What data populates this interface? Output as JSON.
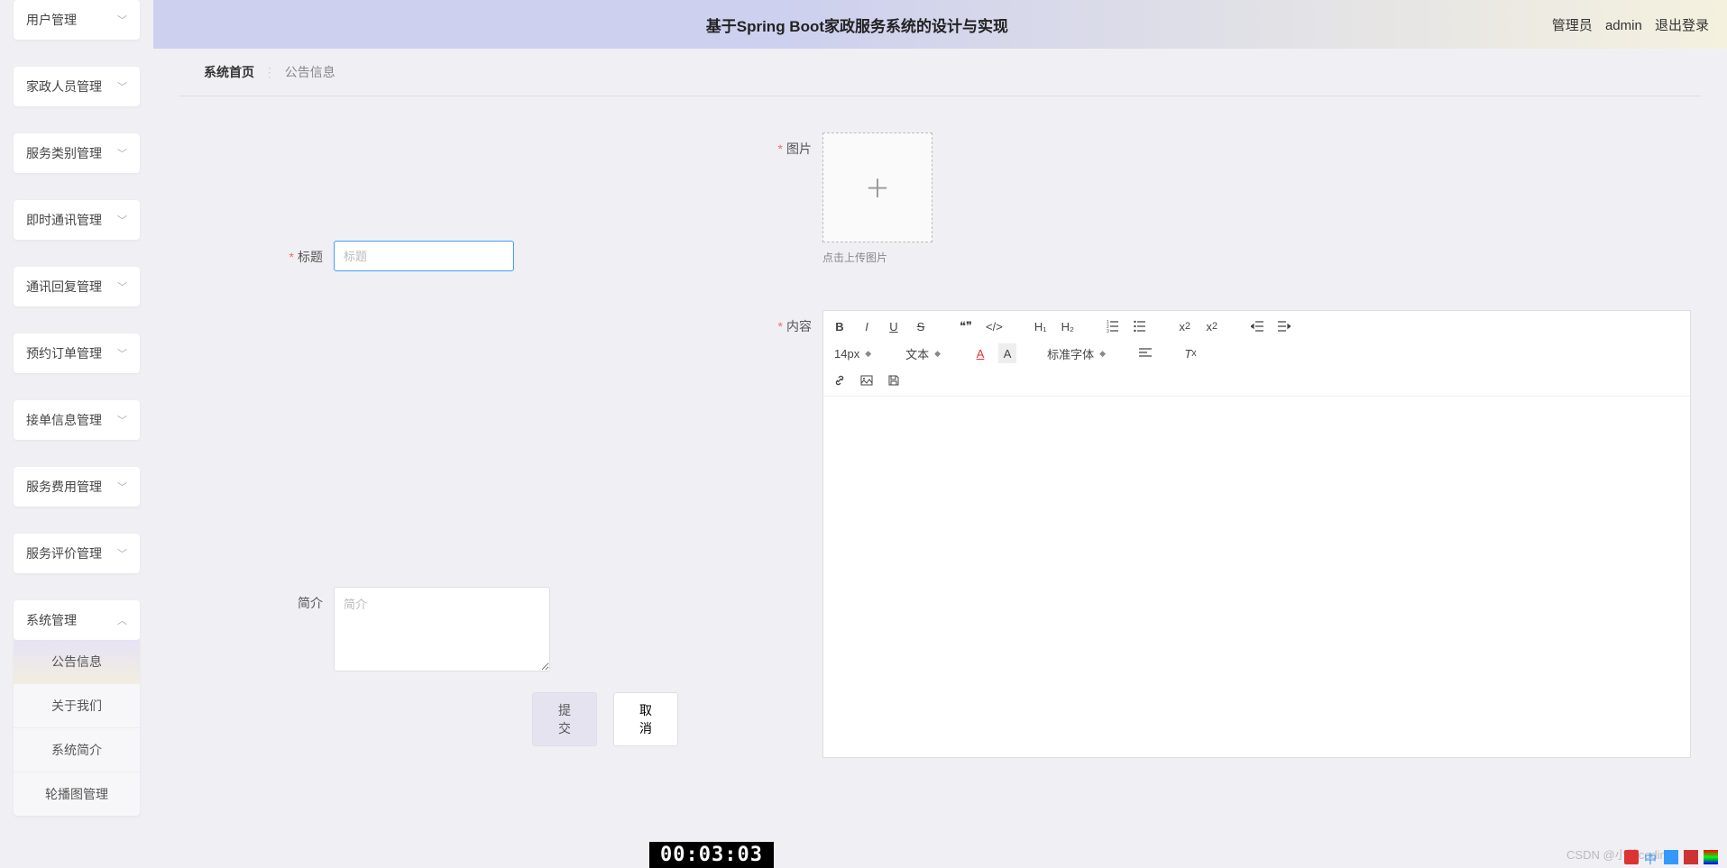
{
  "header": {
    "title": "基于Spring Boot家政服务系统的设计与实现",
    "role": "管理员",
    "user": "admin",
    "logout": "退出登录"
  },
  "breadcrumb": {
    "home": "系统首页",
    "current": "公告信息"
  },
  "sidebar": {
    "items": [
      {
        "label": "用户管理"
      },
      {
        "label": "家政人员管理"
      },
      {
        "label": "服务类别管理"
      },
      {
        "label": "即时通讯管理"
      },
      {
        "label": "通讯回复管理"
      },
      {
        "label": "预约订单管理"
      },
      {
        "label": "接单信息管理"
      },
      {
        "label": "服务费用管理"
      },
      {
        "label": "服务评价管理"
      },
      {
        "label": "系统管理"
      }
    ],
    "sub": [
      {
        "label": "公告信息"
      },
      {
        "label": "关于我们"
      },
      {
        "label": "系统简介"
      },
      {
        "label": "轮播图管理"
      }
    ]
  },
  "form": {
    "title_label": "标题",
    "title_placeholder": "标题",
    "intro_label": "简介",
    "intro_placeholder": "简介",
    "image_label": "图片",
    "upload_hint": "点击上传图片",
    "content_label": "内容",
    "submit": "提交",
    "cancel": "取消"
  },
  "editor": {
    "fontsize": "14px",
    "paragraph": "文本",
    "font": "标准字体",
    "h1": "H₁",
    "h2": "H₂"
  },
  "timer": "00:03:03",
  "watermark": "CSDN @小蔡coding"
}
